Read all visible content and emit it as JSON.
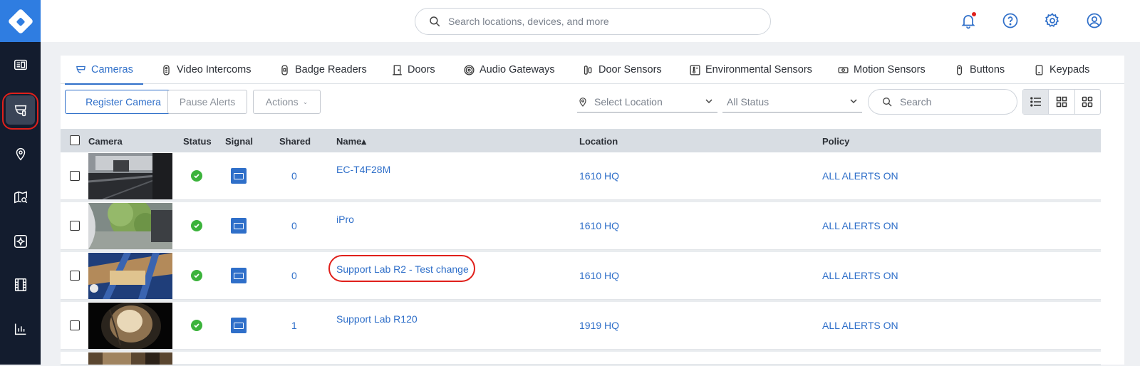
{
  "topbar": {
    "search_placeholder": "Search locations, devices, and more",
    "icons": [
      "bell-icon",
      "help-icon",
      "gear-icon",
      "user-icon"
    ]
  },
  "sidebar": {
    "items": [
      "dashboard-icon",
      "cameras-icon",
      "location-pin-icon",
      "map-search-icon",
      "analytics-icon",
      "film-icon",
      "bar-chart-icon"
    ],
    "active": "cameras-icon"
  },
  "tabs": [
    {
      "label": "Cameras",
      "icon": "camera-icon",
      "active": true
    },
    {
      "label": "Video Intercoms",
      "icon": "intercom-icon"
    },
    {
      "label": "Badge Readers",
      "icon": "badge-reader-icon"
    },
    {
      "label": "Doors",
      "icon": "door-icon"
    },
    {
      "label": "Audio Gateways",
      "icon": "audio-gateway-icon"
    },
    {
      "label": "Door Sensors",
      "icon": "door-sensor-icon"
    },
    {
      "label": "Environmental Sensors",
      "icon": "environmental-sensor-icon"
    },
    {
      "label": "Motion Sensors",
      "icon": "motion-sensor-icon"
    },
    {
      "label": "Buttons",
      "icon": "button-device-icon"
    },
    {
      "label": "Keypads",
      "icon": "keypad-icon"
    }
  ],
  "toolbar": {
    "register_label": "Register Camera",
    "pause_label": "Pause Alerts",
    "actions_label": "Actions",
    "location_placeholder": "Select Location",
    "status_value": "All Status",
    "search_placeholder": "Search"
  },
  "table": {
    "headers": {
      "camera": "Camera",
      "status": "Status",
      "signal": "Signal",
      "shared": "Shared",
      "name": "Name▴",
      "location": "Location",
      "policy": "Policy"
    },
    "rows": [
      {
        "shared": "0",
        "name": "EC-T4F28M",
        "location": "1610 HQ",
        "policy": "ALL ALERTS ON",
        "status": "online"
      },
      {
        "shared": "0",
        "name": "iPro",
        "location": "1610 HQ",
        "policy": "ALL ALERTS ON",
        "status": "online"
      },
      {
        "shared": "0",
        "name": "Support Lab R2 - Test change",
        "location": "1610 HQ",
        "policy": "ALL ALERTS ON",
        "status": "online"
      },
      {
        "shared": "1",
        "name": "Support Lab R120",
        "location": "1919 HQ",
        "policy": "ALL ALERTS ON",
        "status": "online"
      }
    ]
  },
  "colors": {
    "accent": "#2f6fc9",
    "sidebar": "#131c2e",
    "logo": "#2f7de1",
    "status_ok": "#3bb33b",
    "highlight_ring": "#e0201b"
  }
}
